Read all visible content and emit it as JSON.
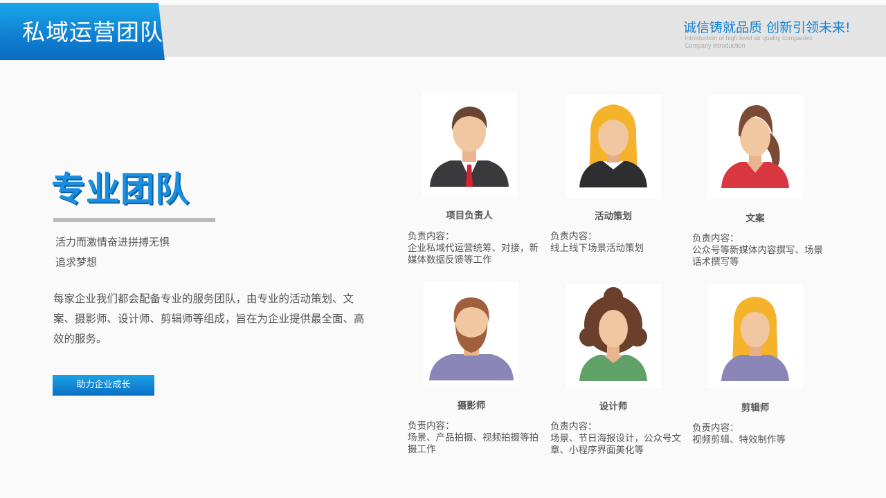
{
  "header": {
    "title": "私域运营团队",
    "slogan": "诚信铸就品质 创新引领未来!",
    "slogan_sub1": "Introduction of high level air quality companies",
    "slogan_sub2": "Company introduction"
  },
  "intro": {
    "heading": "专业团队",
    "tagline1": "活力而激情奋进拼搏无惧",
    "tagline2": "追求梦想",
    "description": "每家企业我们都会配备专业的服务团队，由专业的活动策划、文案、摄影师、设计师、剪辑师等组成，旨在为企业提供最全面、高效的服务。",
    "button_label": "助力企业成长"
  },
  "duty_label": "负责内容：",
  "members": [
    {
      "role": "项目负责人",
      "duty": "企业私域代运营统筹、对接，新媒体数据反馈等工作",
      "avatar": "man-suit-icon"
    },
    {
      "role": "活动策划",
      "duty": "线上线下场景活动策划",
      "avatar": "woman-blonde-icon"
    },
    {
      "role": "文案",
      "duty": "公众号等新媒体内容撰写、场景话术撰写等",
      "avatar": "woman-ponytail-icon"
    },
    {
      "role": "摄影师",
      "duty": "场景、产品拍摄、视频拍摄等拍摄工作",
      "avatar": "man-beard-icon"
    },
    {
      "role": "设计师",
      "duty": "场景、节日海报设计，公众号文章、小程序界面美化等",
      "avatar": "woman-curly-icon"
    },
    {
      "role": "剪辑师",
      "duty": "视频剪辑、特效制作等",
      "avatar": "woman-blonde-purple-icon"
    }
  ],
  "colors": {
    "accent": "#1a8fdf",
    "header_gradient_top": "#1aa6ea",
    "header_gradient_bottom": "#0a6cc0"
  }
}
